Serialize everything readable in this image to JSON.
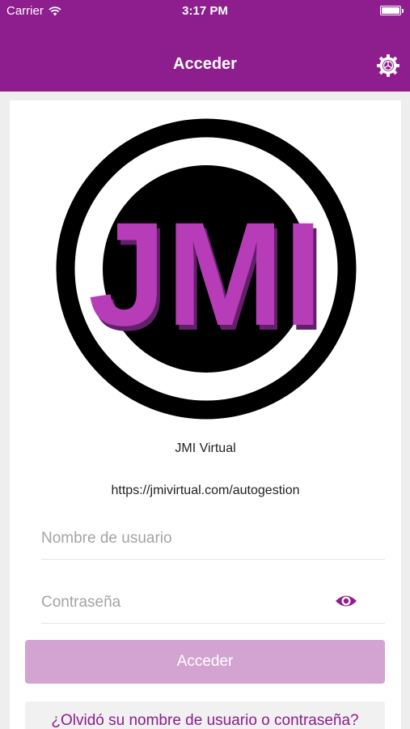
{
  "status_bar": {
    "carrier": "Carrier",
    "time": "3:17 PM",
    "icons": [
      "wifi-icon",
      "battery-icon"
    ]
  },
  "nav": {
    "title": "Acceder",
    "settings_icon": "gear-icon"
  },
  "colors": {
    "brand": "#8e1d8e",
    "button_disabled": "#d3a3d2",
    "logo_magenta": "#b73cb7"
  },
  "logo": {
    "text": "JMI"
  },
  "app": {
    "name": "JMI Virtual",
    "url": "https://jmivirtual.com/autogestion"
  },
  "form": {
    "username": {
      "placeholder": "Nombre de usuario",
      "value": ""
    },
    "password": {
      "placeholder": "Contraseña",
      "value": "",
      "toggle_icon": "eye-icon"
    },
    "submit_label": "Acceder",
    "forgot_label": "¿Olvidó su nombre de usuario o contraseña?"
  }
}
